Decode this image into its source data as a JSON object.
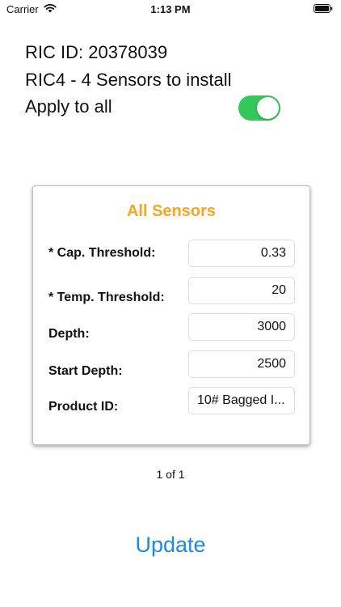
{
  "status_bar": {
    "carrier": "Carrier",
    "time": "1:13 PM",
    "wifi_icon": "wifi-icon",
    "battery_icon": "battery-icon"
  },
  "header": {
    "ric_id": "RIC ID: 20378039",
    "ric_line": "RIC4 - 4 Sensors to install",
    "apply_label": "Apply to all",
    "apply_to_all": true
  },
  "card": {
    "title": "All Sensors",
    "fields": [
      {
        "label": "* Cap. Threshold:",
        "value": "0.33"
      },
      {
        "label": "* Temp. Threshold:",
        "value": "20"
      },
      {
        "label": "Depth:",
        "value": "3000"
      },
      {
        "label": "Start Depth:",
        "value": "2500"
      },
      {
        "label": "Product ID:",
        "value": "10# Bagged I..."
      }
    ]
  },
  "pager": "1 of 1",
  "update_label": "Update",
  "colors": {
    "accent_title": "#f5a623",
    "toggle_on": "#34c759",
    "link_blue": "#1e88e5"
  }
}
